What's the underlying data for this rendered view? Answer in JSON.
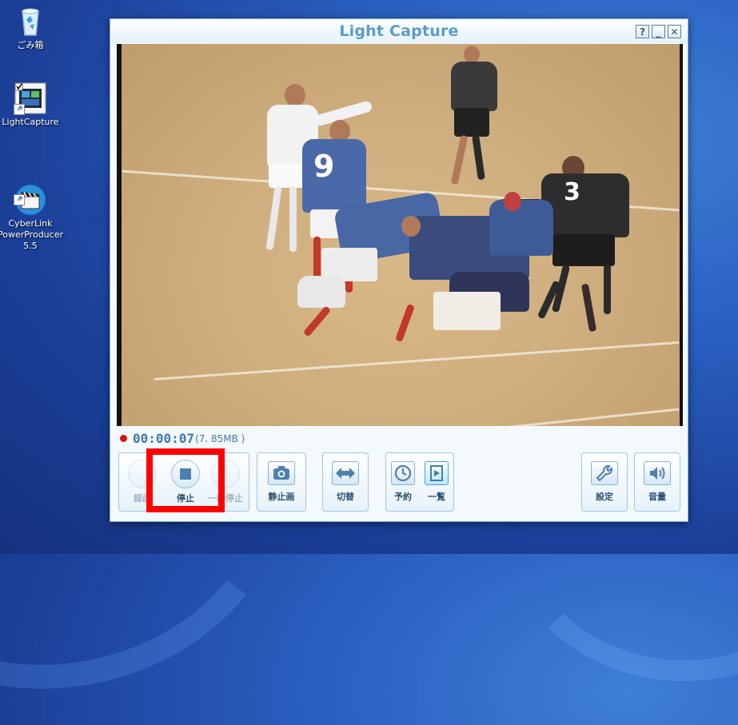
{
  "desktop": {
    "icons": [
      {
        "label": "ごみ箱",
        "icon": "recycle-bin-icon"
      },
      {
        "label": "LightCapture",
        "icon": "film-icon"
      },
      {
        "label": "CyberLink\nPowerProducer 5.5",
        "icon": "clapperboard-icon"
      }
    ]
  },
  "window": {
    "title": "Light Capture",
    "buttons": {
      "help": "?",
      "minimize": "_",
      "close": "✕"
    }
  },
  "status": {
    "timecode": "00:00:07",
    "filesize": "(7. 85MB )",
    "recording_color": "#e01010"
  },
  "controls": {
    "record_label": "録画",
    "stop_label": "停止",
    "pause_label": "一時停止",
    "snapshot_label": "静止画",
    "switch_label": "切替",
    "schedule_label": "予約",
    "list_label": "一覧",
    "settings_label": "設定",
    "volume_label": "音量"
  },
  "video": {
    "jersey_numbers": [
      "9",
      "3"
    ]
  },
  "colors": {
    "accent": "#5a9ccc",
    "highlight": "#ff0000"
  }
}
